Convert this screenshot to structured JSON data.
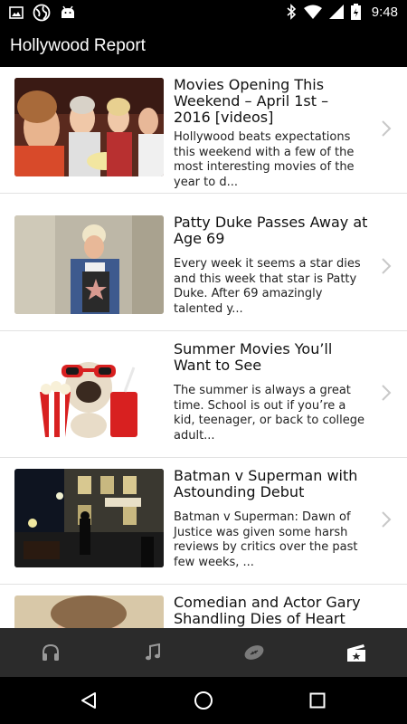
{
  "status_bar": {
    "time": "9:48",
    "left_icons": [
      "image-icon",
      "globe-icon",
      "android-icon"
    ],
    "right_icons": [
      "bluetooth-icon",
      "wifi-icon",
      "signal-icon",
      "battery-icon"
    ]
  },
  "app_bar": {
    "title": "Hollywood Report"
  },
  "articles": [
    {
      "title": "Movies Opening This Weekend – April 1st – 2016 [videos]",
      "excerpt": "Hollywood beats expectations this weekend with a few of the most interesting movies of the year to d..."
    },
    {
      "title": "Patty Duke Passes Away at Age 69",
      "excerpt": "Every week it seems a star dies and this week that star is Patty Duke. After 69 amazingly talented y..."
    },
    {
      "title": "Summer Movies You’ll Want to See",
      "excerpt": "The summer is always a great time. School is out if you’re a kid, teenager, or back to college adult..."
    },
    {
      "title": "Batman v Superman with Astounding Debut",
      "excerpt": "Batman v Superman: Dawn of Justice was given some harsh reviews by critics over the past few weeks, ..."
    },
    {
      "title": "Comedian and Actor Gary Shandling Dies of Heart",
      "excerpt": ""
    }
  ],
  "bottom_nav": {
    "tabs": [
      "headphones-icon",
      "music-note-icon",
      "football-icon",
      "movie-ticket-icon"
    ],
    "active_tab": "movie-ticket-icon"
  },
  "system_nav": [
    "back-icon",
    "home-icon",
    "recents-icon"
  ],
  "colors": {
    "app_bar": "#000000",
    "bottom_nav": "#2b2b2b",
    "divider": "#e2e2e2",
    "chevron": "#c8c8c8"
  }
}
